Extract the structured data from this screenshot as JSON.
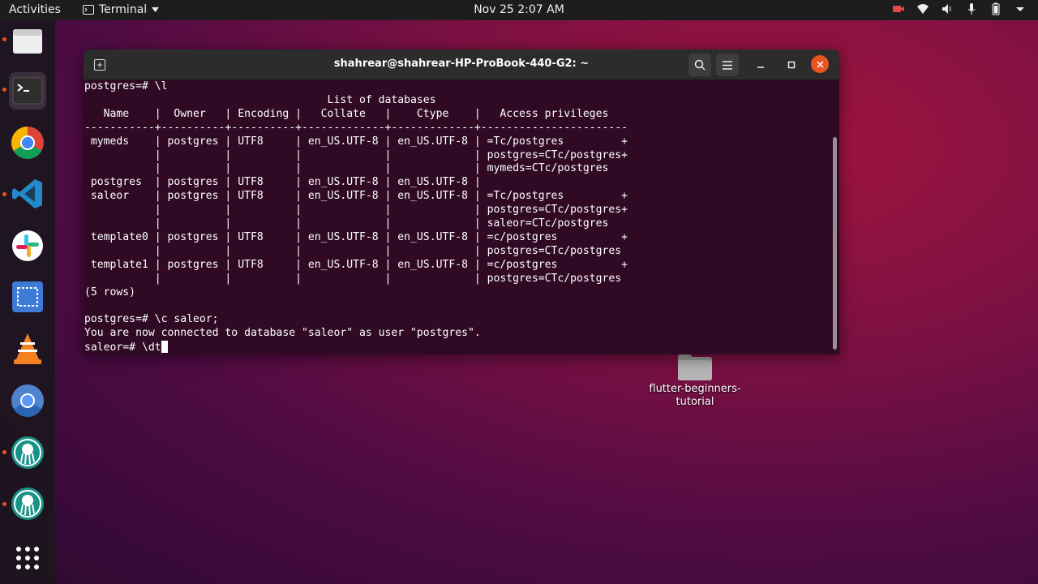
{
  "topbar": {
    "activities": "Activities",
    "app_name": "Terminal",
    "clock": "Nov 25  2:07 AM"
  },
  "desktop": {
    "folder_label": "flutter-beginners-\ntutorial"
  },
  "terminal": {
    "title": "shahrear@shahrear-HP-ProBook-440-G2: ~",
    "lines": [
      "postgres=# \\l",
      "                                      List of databases",
      "   Name    |  Owner   | Encoding |   Collate   |    Ctype    |   Access privileges   ",
      "-----------+----------+----------+-------------+-------------+-----------------------",
      " mymeds    | postgres | UTF8     | en_US.UTF-8 | en_US.UTF-8 | =Tc/postgres         +",
      "           |          |          |             |             | postgres=CTc/postgres+",
      "           |          |          |             |             | mymeds=CTc/postgres",
      " postgres  | postgres | UTF8     | en_US.UTF-8 | en_US.UTF-8 | ",
      " saleor    | postgres | UTF8     | en_US.UTF-8 | en_US.UTF-8 | =Tc/postgres         +",
      "           |          |          |             |             | postgres=CTc/postgres+",
      "           |          |          |             |             | saleor=CTc/postgres",
      " template0 | postgres | UTF8     | en_US.UTF-8 | en_US.UTF-8 | =c/postgres          +",
      "           |          |          |             |             | postgres=CTc/postgres",
      " template1 | postgres | UTF8     | en_US.UTF-8 | en_US.UTF-8 | =c/postgres          +",
      "           |          |          |             |             | postgres=CTc/postgres",
      "(5 rows)",
      "",
      "postgres=# \\c saleor;",
      "You are now connected to database \"saleor\" as user \"postgres\"."
    ],
    "prompt": "saleor=# ",
    "input": "\\dt"
  },
  "colors": {
    "terminal_bg": "#300a24",
    "titlebar_bg": "#2c2c2c",
    "close_button": "#e95420",
    "topbar_bg": "#1d1d1d"
  },
  "icons": {
    "dock": [
      "files-icon",
      "terminal-icon",
      "chrome-icon",
      "vscode-icon",
      "slack-icon",
      "screenshot-icon",
      "vlc-icon",
      "chromium-icon",
      "gitkraken-icon",
      "gitkraken-icon",
      "show-apps-icon"
    ],
    "titlebar": [
      "new-tab-icon",
      "search-icon",
      "hamburger-menu-icon",
      "minimize-icon",
      "maximize-icon",
      "close-icon"
    ]
  }
}
